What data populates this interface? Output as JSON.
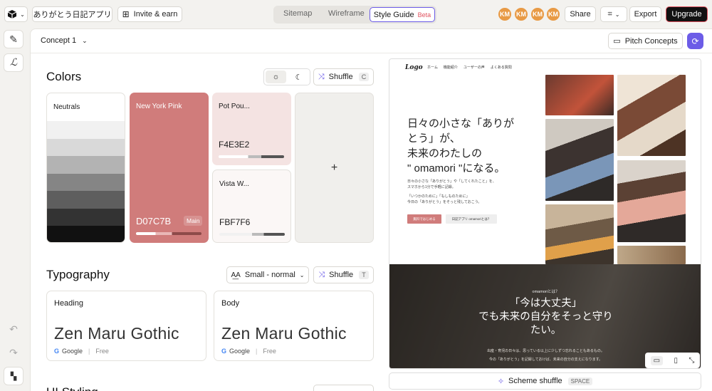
{
  "topbar": {
    "project_name": "ありがとう日記アプリ",
    "invite": "Invite & earn",
    "tabs": [
      {
        "label": "Sitemap"
      },
      {
        "label": "Wireframe"
      },
      {
        "label": "Style Guide",
        "badge": "Beta"
      }
    ],
    "avatars": [
      "KM",
      "KM",
      "KM",
      "KM"
    ],
    "share": "Share",
    "export": "Export",
    "upgrade": "Upgrade"
  },
  "subbar": {
    "concept": "Concept 1",
    "pitch": "Pitch Concepts"
  },
  "colors": {
    "title": "Colors",
    "shuffle": "Shuffle",
    "shuffle_key": "C",
    "neutrals": {
      "label": "Neutrals",
      "shades": [
        "#ffffff",
        "#f1f1f1",
        "#d9d9d9",
        "#b3b3b3",
        "#858585",
        "#5e5e5e",
        "#333333",
        "#111111"
      ]
    },
    "main": {
      "label": "New York Pink",
      "hex": "D07C7B",
      "badge": "Main",
      "color": "#d07c7b"
    },
    "secondary": {
      "label": "Pot Pou...",
      "hex": "F4E3E2",
      "color": "#f4e3e2"
    },
    "tertiary": {
      "label": "Vista W...",
      "hex": "FBF7F6",
      "color": "#fbf7f6"
    },
    "add": "+"
  },
  "typography": {
    "title": "Typography",
    "size_select": "Small - normal",
    "shuffle": "Shuffle",
    "shuffle_key": "T",
    "heading": {
      "label": "Heading",
      "font": "Zen Maru Gothic",
      "source": "Google",
      "license": "Free"
    },
    "body": {
      "label": "Body",
      "font": "Zen Maru Gothic",
      "source": "Google",
      "license": "Free"
    }
  },
  "ui_styling": {
    "title": "UI Styling"
  },
  "preview": {
    "logo": "Logo",
    "nav": [
      "ホーム",
      "機能紹介",
      "ユーザーの声",
      "よくある質問"
    ],
    "hero_lines": [
      "日々の小さな「ありが",
      "とう」が、",
      "未来のわたしの",
      "\" omamori \"になる。"
    ],
    "hero_sub": [
      "日々の小さな「ありがとう」や「してくれたこと」を、",
      "スマホから1分で手軽に記録。"
    ],
    "hero_sub2": [
      "「いつかのために」「もしものために」",
      "今日の「ありがとう」をそっと残しておこう。"
    ],
    "cta_primary": "無料ではじめる",
    "cta_secondary": "日記アプリ omamoriとは？",
    "section_label": "omamoriとは？",
    "section_lines": [
      "「今は大丈夫」",
      "でも未来の自分をそっと守り",
      "たい。"
    ],
    "section_sub": [
      "出産・育児の日々は、思っている以上に少しずつ忘れることもあるもの。",
      "今の「ありがとう」を記録しておけば、未来の自分の支えになります。"
    ],
    "accent": "#d07c7b"
  },
  "scheme": {
    "label": "Scheme shuffle",
    "key": "SPACE"
  }
}
